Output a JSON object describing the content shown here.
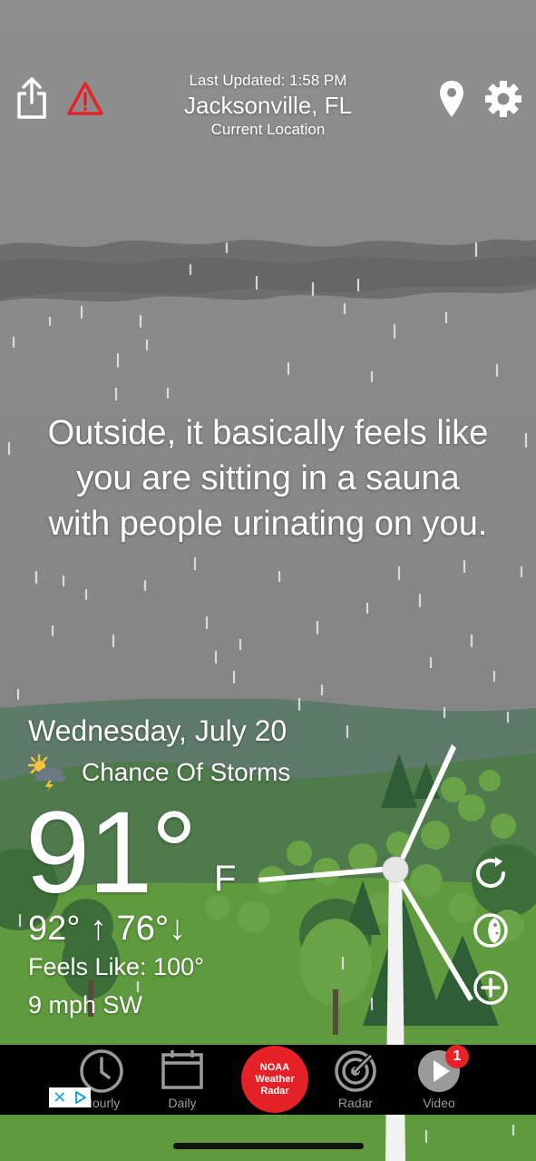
{
  "header": {
    "last_updated": "Last Updated: 1:58 PM",
    "city": "Jacksonville, FL",
    "location_label": "Current Location"
  },
  "quote": {
    "line1": "Outside, it basically feels like",
    "line2": "you are sitting in a sauna",
    "line3": "with people urinating on you."
  },
  "current": {
    "date": "Wednesday, July 20",
    "condition": "Chance Of Storms",
    "condition_icon": "partly-cloudy-storm-icon",
    "temperature": "91°",
    "unit": "F",
    "high": "92°",
    "low": "76°",
    "feels_like": "Feels Like: 100°",
    "wind": "9 mph SW"
  },
  "tabs": {
    "hourly": "Hourly",
    "daily": "Daily",
    "noaa_line1": "NOAA",
    "noaa_line2": "Weather",
    "noaa_line3": "Radar",
    "radar": "Radar",
    "video": "Video",
    "video_badge": "1"
  },
  "colors": {
    "sky": "#8a8a8a",
    "grass": "#5f9a3e",
    "accent_red": "#e42228",
    "tabbar": "#000000"
  }
}
